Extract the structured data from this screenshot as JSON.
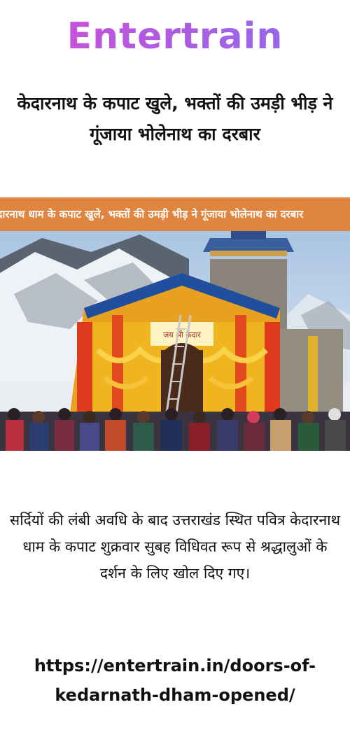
{
  "brand": {
    "logo_text": "Entertrain"
  },
  "article": {
    "headline": "केदारनाथ के कपाट खुले, भक्तों की उमड़ी भीड़ ने गूंजाया भोलेनाथ का दरबार",
    "image_banner": "केदारनाथ धाम के कपाट खुले, भक्तों की उमड़ी भीड़ ने गूंजाया भोलेनाथ का दरबार",
    "image_sign": "जय श्री केदार",
    "summary": "सर्दियों की लंबी अवधि के बाद उत्तराखंड स्थित पवित्र केदारनाथ धाम के कपाट शुक्रवार सुबह विधिवत रूप से श्रद्धालुओं के दर्शन के लिए खोल दिए गए।",
    "link": "https://entertrain.in/doors-of-kedarnath-dham-opened/"
  },
  "colors": {
    "banner_bg": "#e0853f",
    "logo_gradient_start": "#d64fd8",
    "logo_gradient_end": "#8a6ef0"
  }
}
